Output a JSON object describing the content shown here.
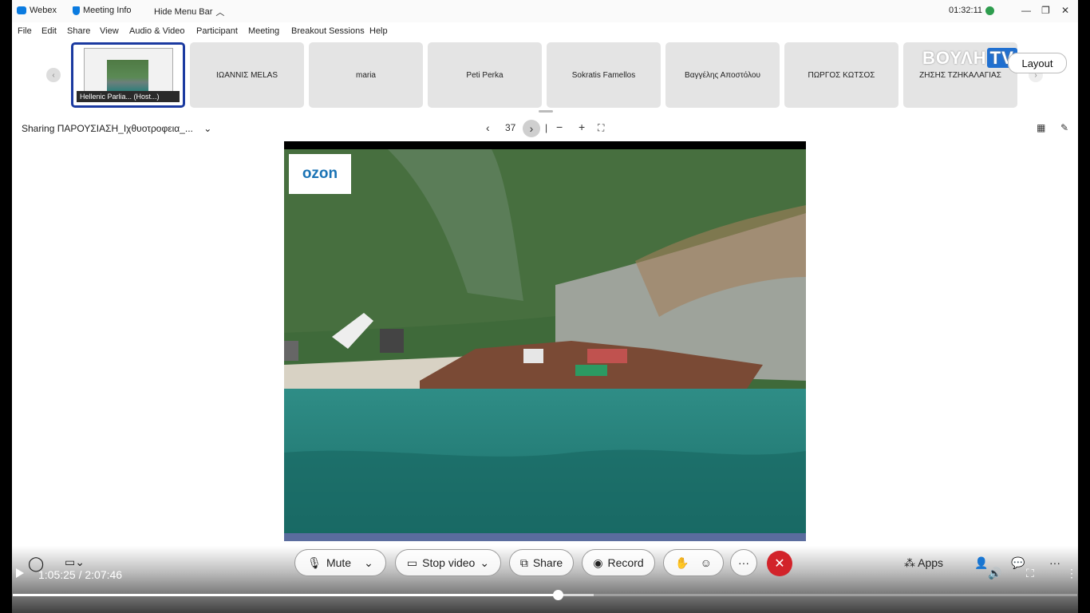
{
  "titlebar": {
    "app_name": "Webex",
    "meeting_info": "Meeting Info",
    "hide_menu": "Hide Menu Bar",
    "clock": "01:32:11"
  },
  "menubar": {
    "items": [
      "File",
      "Edit",
      "Share",
      "View",
      "Audio & Video",
      "Participant",
      "Meeting",
      "Breakout Sessions",
      "Help"
    ]
  },
  "participants": {
    "active_label": "Hellenic Parlia... (Host...)",
    "tiles": [
      "ΙΩΑΝΝΙΣ MELAS",
      "maria",
      "Peti Perka",
      "Sokratis Famellos",
      "Βαγγέλης Αποστόλου",
      "ΠΩΡΓΟΣ ΚΩΤΣΟΣ",
      "ΖΗΣΗΣ ΤΖΗΚΑΛΑΓΙΑΣ"
    ]
  },
  "overlay": {
    "channel_text": "ΒΟΥΛΗ",
    "channel_tv": "TV",
    "layout_label": "Layout"
  },
  "share": {
    "title": "Sharing ΠΑΡΟΥΣΙΑΣΗ_Ιχθυοτροφεια_...",
    "page_number": "37",
    "divider": "|",
    "zoom_out": "−",
    "zoom_in": "+"
  },
  "slide": {
    "logo_text": "ozon"
  },
  "controls": {
    "mute": "Mute",
    "stop_video": "Stop video",
    "share": "Share",
    "record": "Record",
    "more": "···",
    "apps": "Apps"
  },
  "player": {
    "time": "1:05:25 / 2:07:46",
    "progress_fraction": 0.512,
    "buffer_fraction": 0.546
  }
}
